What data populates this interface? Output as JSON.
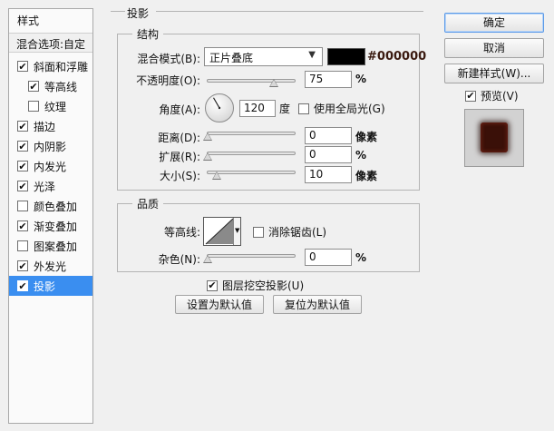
{
  "left_panel": {
    "title": "样式",
    "blending_options": "混合选项:自定",
    "items": [
      {
        "label": "斜面和浮雕",
        "checked": true
      },
      {
        "label": "等高线",
        "checked": true,
        "sub": true
      },
      {
        "label": "纹理",
        "checked": false,
        "sub": true
      },
      {
        "label": "描边",
        "checked": true
      },
      {
        "label": "内阴影",
        "checked": true
      },
      {
        "label": "内发光",
        "checked": true
      },
      {
        "label": "光泽",
        "checked": true
      },
      {
        "label": "颜色叠加",
        "checked": false
      },
      {
        "label": "渐变叠加",
        "checked": true
      },
      {
        "label": "图案叠加",
        "checked": false
      },
      {
        "label": "外发光",
        "checked": true
      },
      {
        "label": "投影",
        "checked": true,
        "active": true
      }
    ]
  },
  "drop_shadow": {
    "section_title": "投影",
    "structure": {
      "title": "结构",
      "blend_mode_label": "混合模式(B):",
      "blend_mode_value": "正片叠底",
      "color": "#000000",
      "color_hex_label": "#000000",
      "opacity_label": "不透明度(O):",
      "opacity_value": "75",
      "opacity_unit": "%",
      "opacity_fraction": 0.75,
      "angle_label": "角度(A):",
      "angle_value": "120",
      "angle_unit": "度",
      "global_light_label": "使用全局光(G)",
      "global_light_checked": false,
      "distance_label": "距离(D):",
      "distance_value": "0",
      "distance_unit": "像素",
      "spread_label": "扩展(R):",
      "spread_value": "0",
      "spread_unit": "%",
      "size_label": "大小(S):",
      "size_value": "10",
      "size_unit": "像素"
    },
    "quality": {
      "title": "品质",
      "contour_label": "等高线:",
      "antialias_label": "消除锯齿(L)",
      "antialias_checked": false,
      "noise_label": "杂色(N):",
      "noise_value": "0",
      "noise_unit": "%"
    },
    "knockout_label": "图层挖空投影(U)",
    "knockout_checked": true,
    "make_default_label": "设置为默认值",
    "reset_default_label": "复位为默认值"
  },
  "right_panel": {
    "ok_label": "确定",
    "cancel_label": "取消",
    "new_style_label": "新建样式(W)...",
    "preview_label": "预览(V)",
    "preview_checked": true,
    "preview_swatch_color": "#3a1008"
  }
}
